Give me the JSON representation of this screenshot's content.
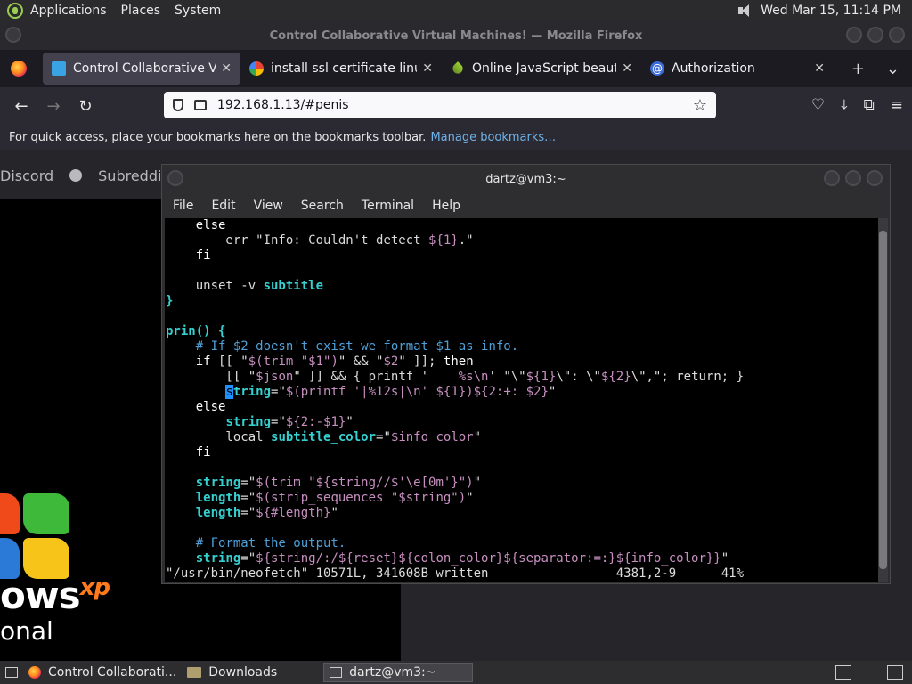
{
  "topbar": {
    "menus": [
      "Applications",
      "Places",
      "System"
    ],
    "datetime": "Wed Mar 15, 11:14 PM"
  },
  "firefox": {
    "window_title": "Control Collaborative Virtual Machines! — Mozilla Firefox",
    "tabs": [
      {
        "label": "Control Collaborative Virtual",
        "icon": "monitor-icon"
      },
      {
        "label": "install ssl certificate linux - G",
        "icon": "google-icon"
      },
      {
        "label": "Online JavaScript beautifier",
        "icon": "js-beautifier-icon"
      },
      {
        "label": "Authorization",
        "icon": "at-icon"
      }
    ],
    "url": "192.168.1.13/#penis",
    "bookmarks_text": "For quick access, place your bookmarks here on the bookmarks toolbar.",
    "bookmarks_link": "Manage bookmarks…"
  },
  "webpage": {
    "nav": [
      "Discord",
      "Subreddit"
    ],
    "xp_word": "ows",
    "xp_sup": "xp",
    "xp_sub": "onal"
  },
  "terminal": {
    "title": "dartz@vm3:~",
    "menu": [
      "File",
      "Edit",
      "View",
      "Search",
      "Terminal",
      "Help"
    ],
    "status_file": "\"/usr/bin/neofetch\" 10571L, 341608B written",
    "status_pos": "4381,2-9",
    "status_pct": "41%"
  },
  "taskbar": {
    "items": [
      "Control Collaborati...",
      "Downloads",
      "dartz@vm3:~"
    ]
  },
  "colors": {
    "term_var": "#36d0d0",
    "term_comment": "#4fa0d8",
    "term_subst": "#c78fc0",
    "link": "#6fb2e8"
  }
}
